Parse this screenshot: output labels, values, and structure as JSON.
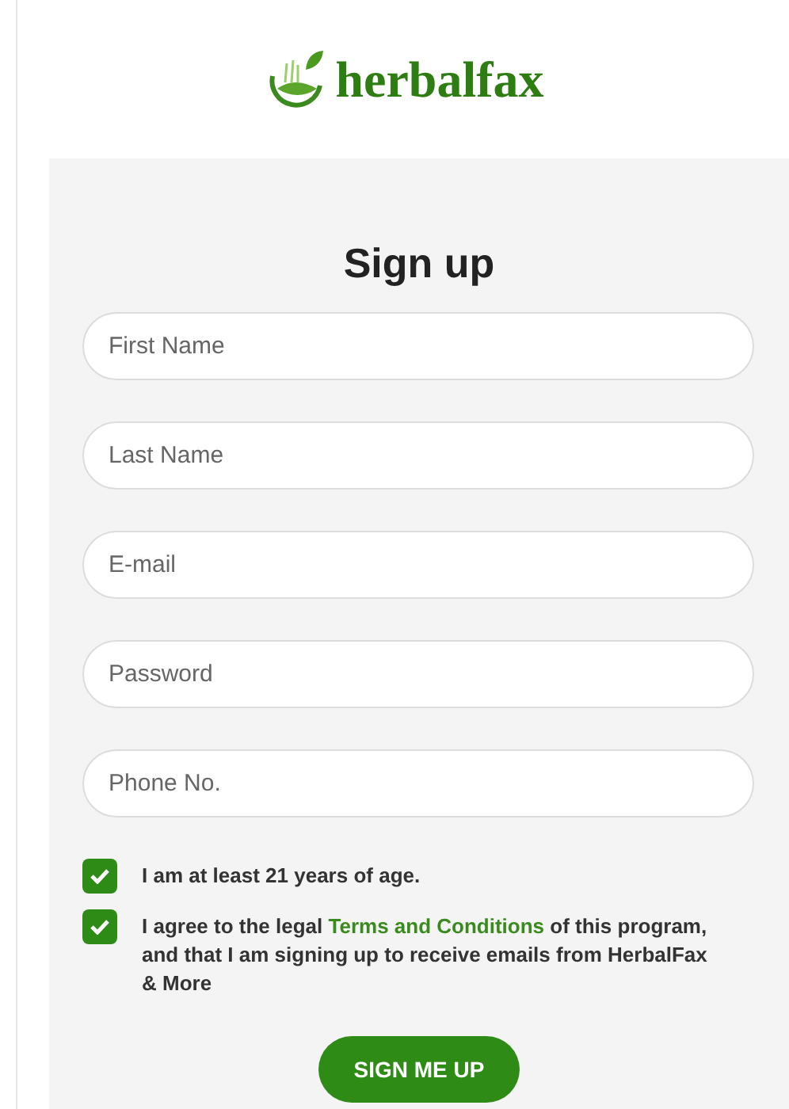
{
  "logo": {
    "text": "herbalfax"
  },
  "title": "Sign up",
  "fields": [
    {
      "placeholder": "First Name"
    },
    {
      "placeholder": "Last Name"
    },
    {
      "placeholder": "E-mail"
    },
    {
      "placeholder": "Password"
    },
    {
      "placeholder": "Phone No."
    }
  ],
  "agreements": [
    {
      "checked": true,
      "text": "I am at least 21 years of age."
    },
    {
      "checked": true,
      "text": "I agree to the legal ",
      "link": "Terms and Conditions",
      "text_after": " of this program, and that I am signing up to receive emails from HerbalFax & More"
    }
  ],
  "submit": "SIGN ME UP"
}
